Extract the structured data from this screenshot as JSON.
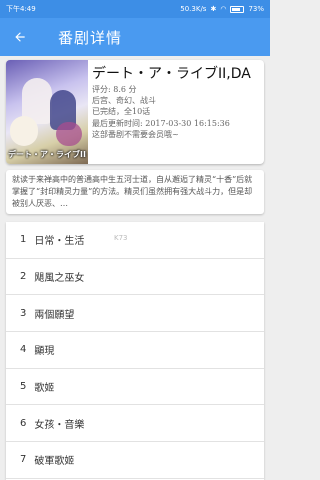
{
  "status_bar": {
    "time": "下午4:49",
    "network": "50.3K/s",
    "battery": "73%"
  },
  "app_bar": {
    "title": "番剧详情"
  },
  "anime": {
    "title": "デート・ア・ライブII,DA",
    "cover_logo": "デート・ア・ライブII",
    "rating": "评分: 8.6 分",
    "tags": "后宫、奇幻、战斗",
    "status": "已完结，全10话",
    "updated": "最后更新时间: 2017-03-30 16:15:36",
    "member_note": "这部番剧不需要会员哦~"
  },
  "synopsis": "就读于来禅高中的普通高中生五河士道，自从邂逅了精灵“十香”后就掌握了“封印精灵力量”的方法。精灵们虽然拥有强大战斗力，但是却被别人厌恶、…",
  "episodes": [
    {
      "num": "1",
      "title": "日常・生活"
    },
    {
      "num": "2",
      "title": "飓風之巫女"
    },
    {
      "num": "3",
      "title": "兩個願望"
    },
    {
      "num": "4",
      "title": "顯現"
    },
    {
      "num": "5",
      "title": "歌姬"
    },
    {
      "num": "6",
      "title": "女孩・音樂"
    },
    {
      "num": "7",
      "title": "破軍歌姬"
    }
  ],
  "watermark": "K73"
}
